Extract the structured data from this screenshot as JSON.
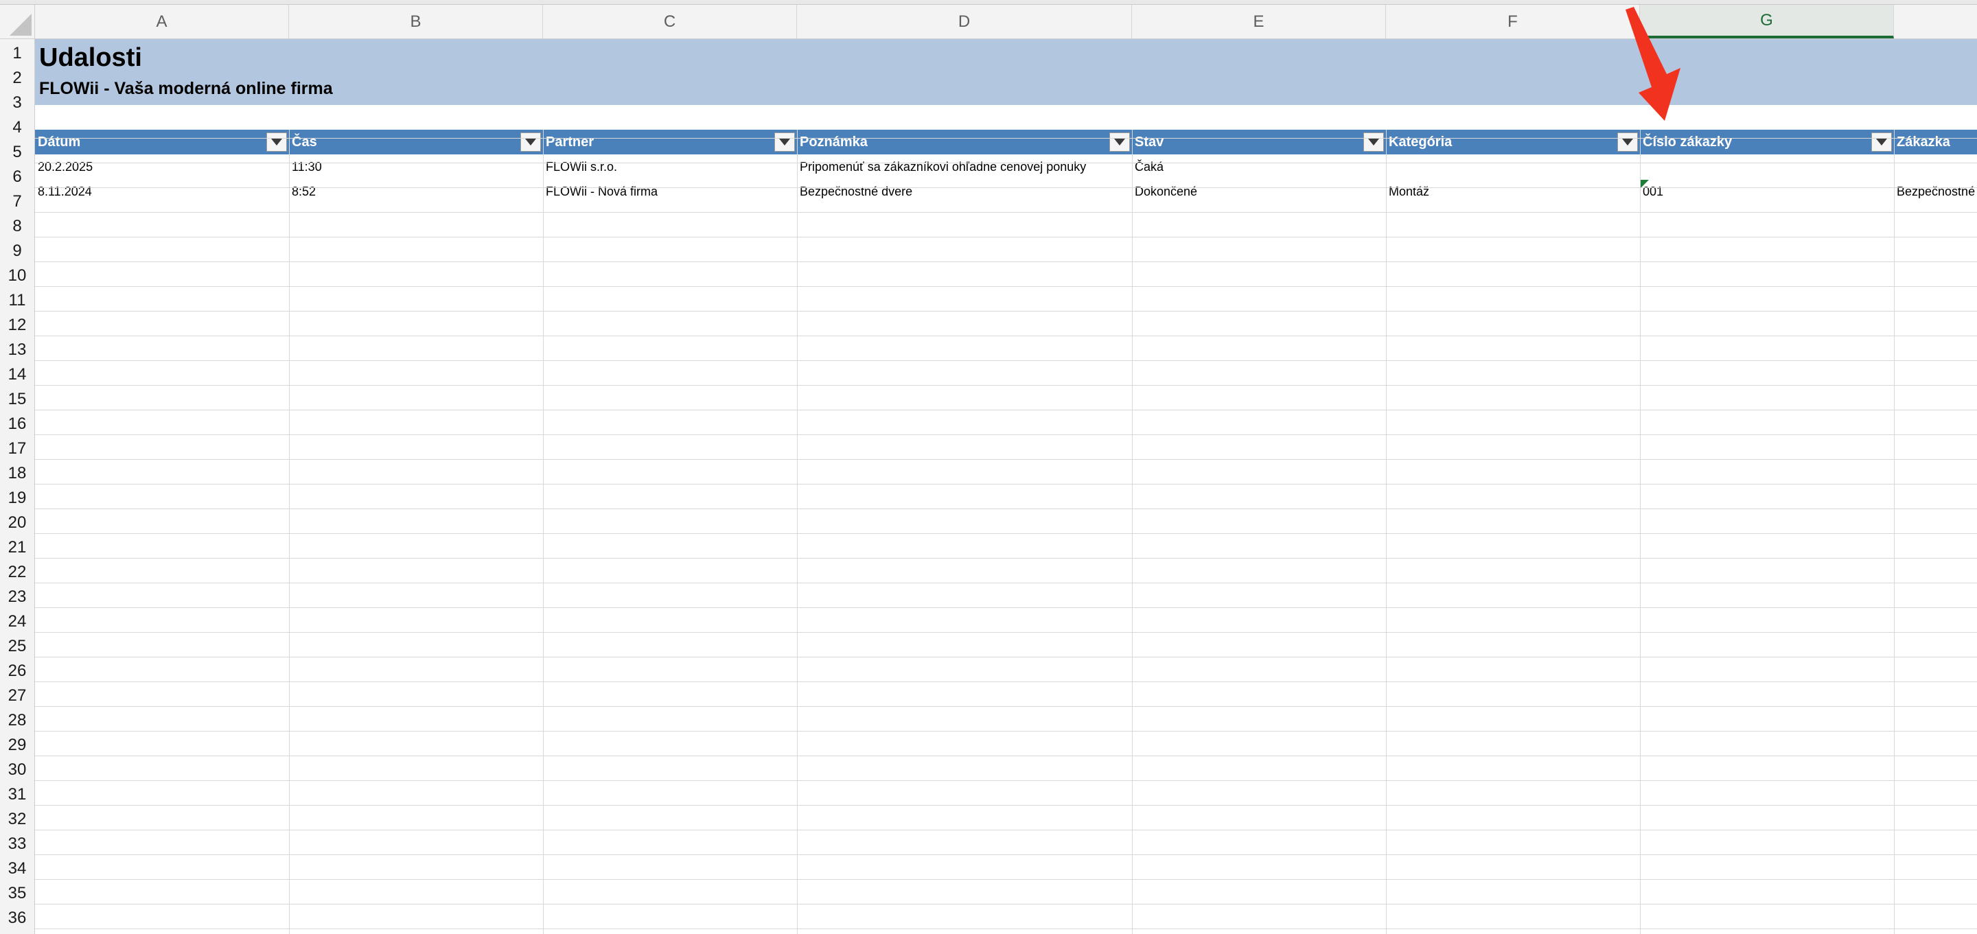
{
  "columns": [
    "A",
    "B",
    "C",
    "D",
    "E",
    "F",
    "G"
  ],
  "active_column": "G",
  "rows": [
    "1",
    "2",
    "3",
    "4",
    "5",
    "6",
    "7",
    "8",
    "9",
    "10",
    "11",
    "12",
    "13",
    "14",
    "15",
    "16",
    "17",
    "18",
    "19",
    "20",
    "21",
    "22",
    "23",
    "24",
    "25",
    "26",
    "27",
    "28",
    "29",
    "30",
    "31",
    "32",
    "33",
    "34",
    "35",
    "36"
  ],
  "sheet": {
    "title": "Udalosti",
    "subtitle": "FLOWii - Vaša moderná online firma"
  },
  "table": {
    "headers": [
      "Dátum",
      "Čas",
      "Partner",
      "Poznámka",
      "Stav",
      "Kategória",
      "Číslo zákazky",
      "Zákazka"
    ],
    "rows": [
      [
        "20.2.2025",
        "11:30",
        "FLOWii s.r.o.",
        "Pripomenúť sa zákazníkovi ohľadne cenovej ponuky",
        "Čaká",
        "",
        "",
        ""
      ],
      [
        "8.11.2024",
        "8:52",
        "FLOWii - Nová firma",
        "Bezpečnostné dvere",
        "Dokončené",
        "Montáž",
        "001",
        "Bezpečnostné d"
      ]
    ]
  },
  "colors": {
    "title_band": "#b3c6df",
    "header_band": "#4a81bb",
    "active_column": "#1d6b35",
    "annotation_arrow": "#f0321e"
  },
  "icons": {
    "filter": "dropdown-filter-icon",
    "annotation": "red-arrow-icon",
    "number_as_text": "error-indicator-icon"
  }
}
